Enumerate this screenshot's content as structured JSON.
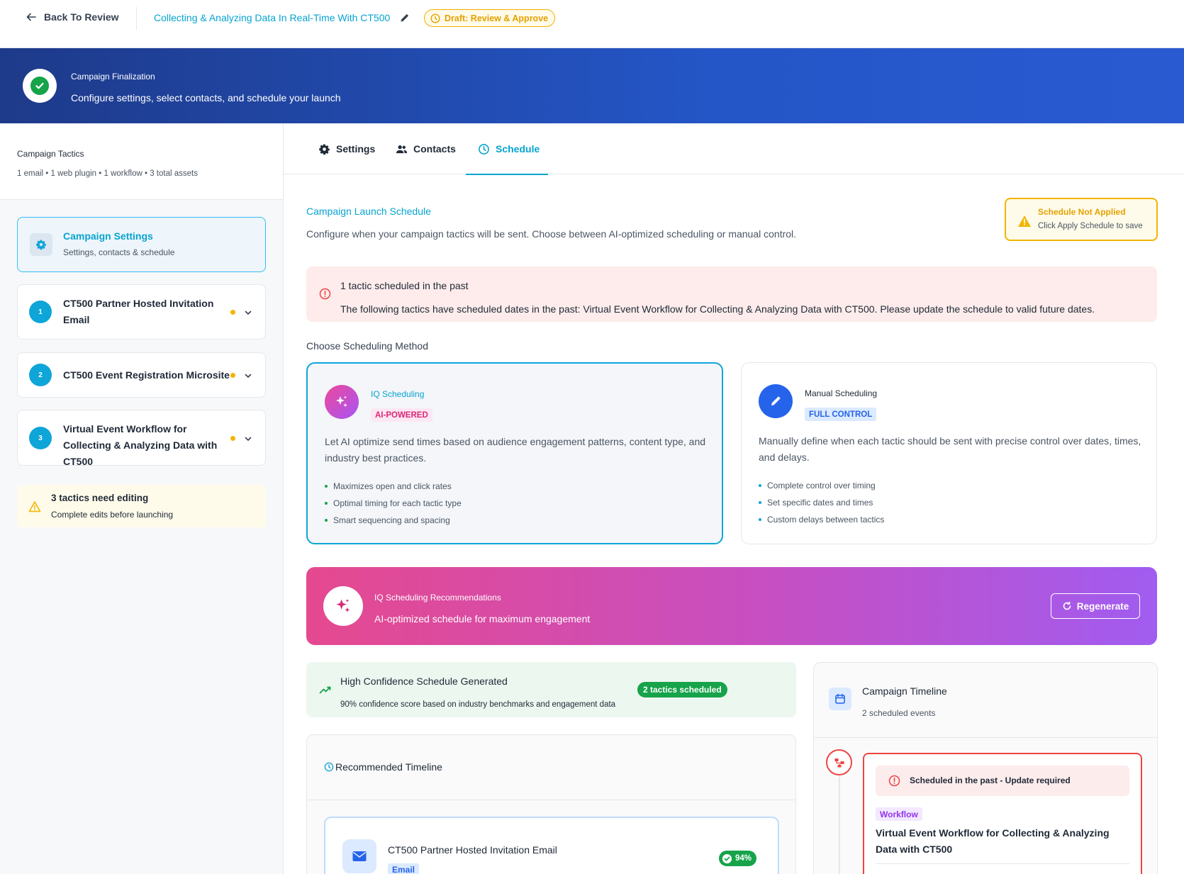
{
  "topbar": {
    "back_label": "Back To Review",
    "campaign_title": "Collecting & Analyzing Data In Real-Time With CT500",
    "status_badge": "Draft: Review & Approve"
  },
  "banner": {
    "eyebrow": "Campaign Finalization",
    "headline": "Configure settings, select contacts, and schedule your launch"
  },
  "sidebar": {
    "heading": "Campaign Tactics",
    "summary": "1 email • 1 web plugin • 1 workflow • 3 total assets",
    "settings_card": {
      "title": "Campaign Settings",
      "subtitle": "Settings, contacts & schedule"
    },
    "tactics": [
      {
        "number": "1",
        "name": "CT500 Partner Hosted Invitation Email"
      },
      {
        "number": "2",
        "name": "CT500 Event Registration Microsite"
      },
      {
        "number": "3",
        "name": "Virtual Event Workflow for Collecting & Analyzing Data with CT500"
      }
    ],
    "warning": {
      "title": "3 tactics need editing",
      "subtitle": "Complete edits before launching"
    }
  },
  "tabs": [
    {
      "label": "Settings",
      "icon": "gear-icon"
    },
    {
      "label": "Contacts",
      "icon": "people-icon"
    },
    {
      "label": "Schedule",
      "icon": "clock-icon"
    }
  ],
  "active_tab": "Schedule",
  "schedule": {
    "title": "Campaign Launch Schedule",
    "subtitle": "Configure when your campaign tactics will be sent. Choose between AI-optimized scheduling or manual control.",
    "not_applied": {
      "title": "Schedule Not Applied",
      "subtitle": "Click Apply Schedule to save"
    },
    "alert": {
      "title": "1 tactic scheduled in the past",
      "message": "The following tactics have scheduled dates in the past: Virtual Event Workflow for Collecting & Analyzing Data with CT500. Please update the schedule to valid future dates."
    },
    "choose_label": "Choose Scheduling Method",
    "methods": {
      "iq": {
        "title": "IQ Scheduling",
        "badge": "AI-POWERED",
        "description": "Let AI optimize send times based on audience engagement patterns, content type, and industry best practices.",
        "bullets": [
          "Maximizes open and click rates",
          "Optimal timing for each tactic type",
          "Smart sequencing and spacing"
        ]
      },
      "manual": {
        "title": "Manual Scheduling",
        "badge": "FULL CONTROL",
        "description": "Manually define when each tactic should be sent with precise control over dates, times, and delays.",
        "bullets": [
          "Complete control over timing",
          "Set specific dates and times",
          "Custom delays between tactics"
        ]
      }
    },
    "recommendations": {
      "title": "IQ Scheduling Recommendations",
      "subtitle": "AI-optimized schedule for maximum engagement",
      "regenerate_label": "Regenerate"
    },
    "confidence": {
      "title": "High Confidence Schedule Generated",
      "subtitle": "90% confidence score based on industry benchmarks and engagement data",
      "pill": "2 tactics scheduled"
    },
    "recommended_timeline": {
      "title": "Recommended Timeline",
      "items": [
        {
          "name": "CT500 Partner Hosted Invitation Email",
          "tag": "Email",
          "score": "94%"
        }
      ]
    },
    "campaign_timeline": {
      "title": "Campaign Timeline",
      "subtitle": "2 scheduled events",
      "events": [
        {
          "warning": "Scheduled in the past - Update required",
          "tag": "Workflow",
          "title": "Virtual Event Workflow for Collecting & Analyzing Data with CT500"
        }
      ]
    }
  },
  "colors": {
    "accent": "#06a4d1",
    "banner_start": "#1e3a8a",
    "warning": "#f4b400",
    "danger": "#ef4444",
    "success": "#16a34a",
    "reco_gradient_start": "#e5498f",
    "reco_gradient_end": "#a15cf0"
  }
}
